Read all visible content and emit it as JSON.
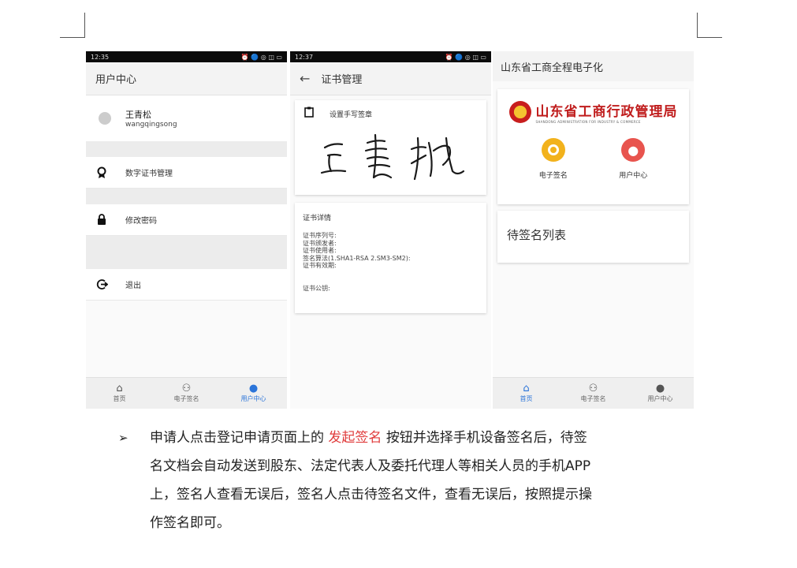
{
  "phone1": {
    "status_time": "12:35",
    "status_icons": "⏰ 🔵 ◎ ◫ ▭",
    "title": "用户中心",
    "user_name": "王青松",
    "user_login": "wangqingsong",
    "menu": [
      {
        "label": "数字证书管理",
        "icon": "certificate-icon"
      },
      {
        "label": "修改密码",
        "icon": "lock-icon"
      },
      {
        "label": "退出",
        "icon": "logout-icon"
      }
    ],
    "nav": [
      {
        "label": "首页",
        "icon": "home-icon"
      },
      {
        "label": "电子签名",
        "icon": "badge-icon"
      },
      {
        "label": "用户中心",
        "icon": "person-icon"
      }
    ]
  },
  "phone2": {
    "status_time": "12:37",
    "status_icons": "⏰ 🔵 ◎ ◫ ▭",
    "title": "证书管理",
    "sig_title": "设置手写签章",
    "cert_title": "证书详情",
    "cert_lines": [
      "证书序列号:",
      "证书颁发者:",
      "证书使用者:",
      "签名算法(1.SHA1-RSA 2.SM3-SM2):",
      "证书有效期:"
    ],
    "cert_pub": "证书公钥:"
  },
  "phone3": {
    "title": "山东省工商全程电子化",
    "logo_main": "山东省工商行政管理局",
    "logo_sub": "SHANDONG ADMINISTRATION FOR INDUSTRY & COMMERCE",
    "shortcut_sign": "电子签名",
    "shortcut_user": "用户中心",
    "pending": "待签名列表",
    "nav": [
      {
        "label": "首页",
        "icon": "home-icon"
      },
      {
        "label": "电子签名",
        "icon": "badge-icon"
      },
      {
        "label": "用户中心",
        "icon": "person-icon"
      }
    ]
  },
  "paragraph": {
    "bullet": "➢",
    "line1_a": "申请人点击登记申请页面上的",
    "line1_hl": "发起签名",
    "line1_b": "按钮并选择手机设备签名后，待签",
    "line2": "名文档会自动发送到股东、法定代表人及委托代理人等相关人员的手机APP",
    "line3": "上，签名人查看无误后，签名人点击待签名文件，查看无误后，按照提示操",
    "line4": "作签名即可。"
  },
  "colors": {
    "accent": "#2b74d9",
    "highlight": "#e03c3c",
    "logo_red": "#c01d1d"
  }
}
